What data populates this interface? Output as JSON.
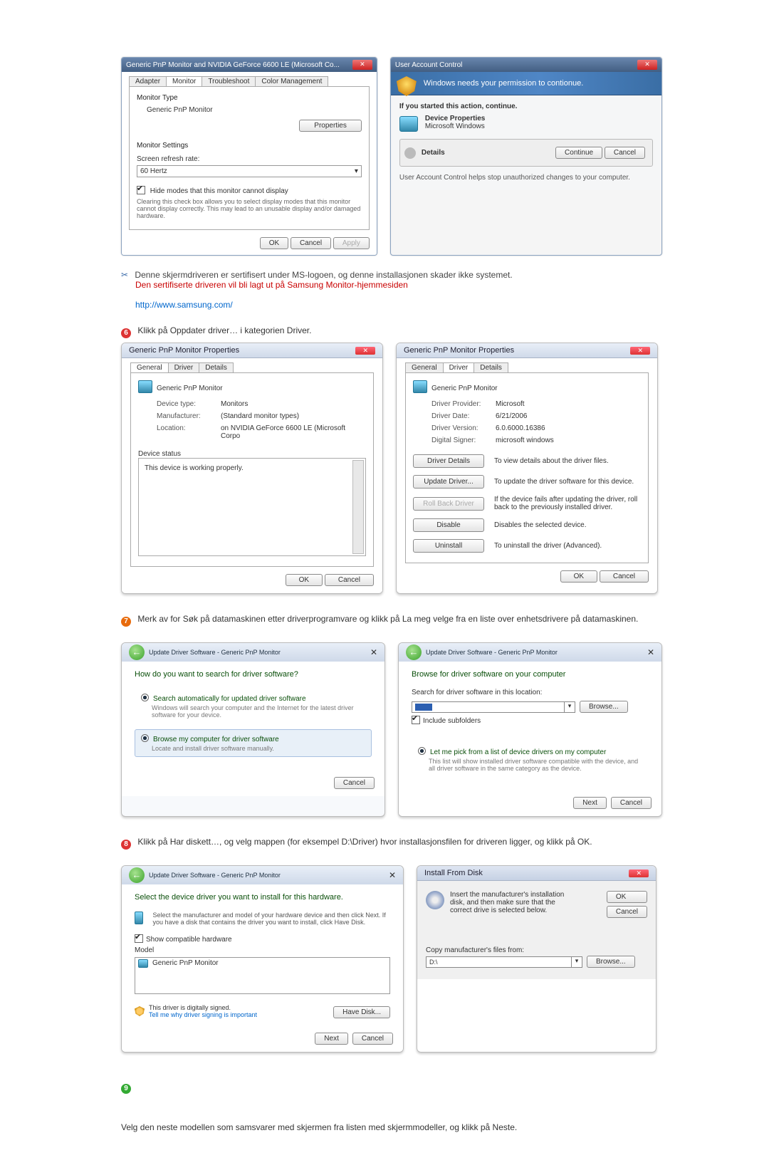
{
  "monitor_props": {
    "title": "Generic PnP Monitor and NVIDIA GeForce 6600 LE (Microsoft Co...",
    "tabs": [
      "Adapter",
      "Monitor",
      "Troubleshoot",
      "Color Management"
    ],
    "monitor_type_label": "Monitor Type",
    "monitor_type_value": "Generic PnP Monitor",
    "properties_btn": "Properties",
    "settings_label": "Monitor Settings",
    "refresh_label": "Screen refresh rate:",
    "refresh_value": "60 Hertz",
    "hide_checkbox": "Hide modes that this monitor cannot display",
    "hide_desc": "Clearing this check box allows you to select display modes that this monitor cannot display correctly. This may lead to an unusable display and/or damaged hardware.",
    "ok": "OK",
    "cancel": "Cancel",
    "apply": "Apply"
  },
  "uac": {
    "title": "User Account Control",
    "banner": "Windows needs your permission to contionue.",
    "started": "If you started this action, continue.",
    "line1": "Device Properties",
    "line2": "Microsoft Windows",
    "details": "Details",
    "continue": "Continue",
    "cancel": "Cancel",
    "footer": "User Account Control helps stop unauthorized changes to your computer."
  },
  "note_cert": {
    "line1": "Denne skjermdriveren er sertifisert under MS-logoen, og denne installasjonen skader ikke systemet.",
    "line2": "Den sertifiserte driveren vil bli lagt ut på Samsung Monitor-hjemmesiden",
    "link": "http://www.samsung.com/"
  },
  "step6": {
    "text": "Klikk på Oppdater driver… i kategorien Driver."
  },
  "props_general": {
    "title": "Generic PnP Monitor Properties",
    "tabs": [
      "General",
      "Driver",
      "Details"
    ],
    "name": "Generic PnP Monitor",
    "dev_type_l": "Device type:",
    "dev_type_v": "Monitors",
    "manu_l": "Manufacturer:",
    "manu_v": "(Standard monitor types)",
    "loc_l": "Location:",
    "loc_v": "on NVIDIA GeForce 6600 LE (Microsoft Corpo",
    "status_l": "Device status",
    "status_v": "This device is working properly.",
    "ok": "OK",
    "cancel": "Cancel"
  },
  "props_driver": {
    "title": "Generic PnP Monitor Properties",
    "name": "Generic PnP Monitor",
    "provider_l": "Driver Provider:",
    "provider_v": "Microsoft",
    "date_l": "Driver Date:",
    "date_v": "6/21/2006",
    "ver_l": "Driver Version:",
    "ver_v": "6.0.6000.16386",
    "signer_l": "Digital Signer:",
    "signer_v": "microsoft windows",
    "btn_details": "Driver Details",
    "btn_details_d": "To view details about the driver files.",
    "btn_update": "Update Driver...",
    "btn_update_d": "To update the driver software for this device.",
    "btn_roll": "Roll Back Driver",
    "btn_roll_d": "If the device fails after updating the driver, roll back to the previously installed driver.",
    "btn_disable": "Disable",
    "btn_disable_d": "Disables the selected device.",
    "btn_uninst": "Uninstall",
    "btn_uninst_d": "To uninstall the driver (Advanced).",
    "ok": "OK",
    "cancel": "Cancel"
  },
  "step7": {
    "text": "Merk av for Søk på datamaskinen etter driverprogramvare og klikk på La meg velge fra en liste over enhetsdrivere på datamaskinen."
  },
  "wiz_search": {
    "crumb": "Update Driver Software - Generic PnP Monitor",
    "q": "How do you want to search for driver software?",
    "opt1_t": "Search automatically for updated driver software",
    "opt1_d": "Windows will search your computer and the Internet for the latest driver software for your device.",
    "opt2_t": "Browse my computer for driver software",
    "opt2_d": "Locate and install driver software manually.",
    "cancel": "Cancel"
  },
  "wiz_browse": {
    "crumb": "Update Driver Software - Generic PnP Monitor",
    "h": "Browse for driver software on your computer",
    "loc_label": "Search for driver software in this location:",
    "browse": "Browse...",
    "include": "Include subfolders",
    "pick_t": "Let me pick from a list of device drivers on my computer",
    "pick_d": "This list will show installed driver software compatible with the device, and all driver software in the same category as the device.",
    "next": "Next",
    "cancel": "Cancel"
  },
  "step8": {
    "text": "Klikk på Har diskett…, og velg mappen (for eksempel D:\\Driver) hvor installasjonsfilen for driveren ligger, og klikk på OK."
  },
  "wiz_model": {
    "crumb": "Update Driver Software - Generic PnP Monitor",
    "h": "Select the device driver you want to install for this hardware.",
    "sub": "Select the manufacturer and model of your hardware device and then click Next. If you have a disk that contains the driver you want to install, click Have Disk.",
    "show": "Show compatible hardware",
    "model_l": "Model",
    "model_v": "Generic PnP Monitor",
    "signed": "This driver is digitally signed.",
    "why": "Tell me why driver signing is important",
    "havedisk": "Have Disk...",
    "next": "Next",
    "cancel": "Cancel"
  },
  "ifd": {
    "title": "Install From Disk",
    "msg": "Insert the manufacturer's installation disk, and then make sure that the correct drive is selected below.",
    "ok": "OK",
    "cancel": "Cancel",
    "copy_l": "Copy manufacturer's files from:",
    "path": "D:\\",
    "browse": "Browse..."
  },
  "closing": {
    "text": "Velg den neste modellen som samsvarer med skjermen fra listen med skjermmodeller, og klikk på Neste."
  }
}
